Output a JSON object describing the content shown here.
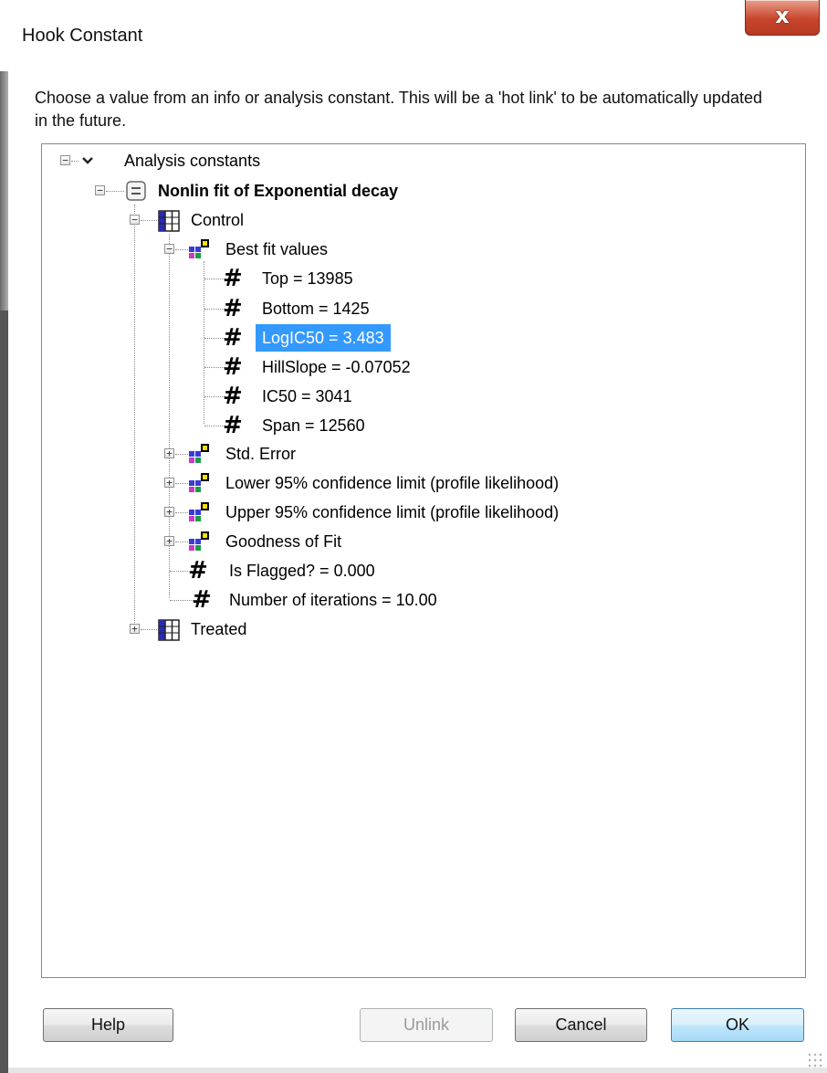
{
  "window": {
    "title": "Hook Constant",
    "close_glyph": "x"
  },
  "description": "Choose a value from an info or analysis constant. This will be a 'hot link' to be automatically updated in the future.",
  "tree": {
    "root": "Analysis constants",
    "analysis": "Nonlin fit of Exponential decay",
    "control": "Control",
    "best_fit": "Best fit values",
    "values": [
      "Top = 13985",
      "Bottom = 1425",
      "LogIC50 = 3.483",
      "HillSlope = -0.07052",
      "IC50 = 3041",
      "Span = 12560"
    ],
    "groups": [
      "Std. Error",
      "Lower 95% confidence limit (profile likelihood)",
      "Upper 95% confidence limit (profile likelihood)",
      "Goodness of Fit"
    ],
    "flagged": "Is Flagged? = 0.000",
    "iterations": "Number of iterations = 10.00",
    "treated": "Treated",
    "hash_glyph": "#",
    "selected_item": "LogIC50 = 3.483"
  },
  "buttons": {
    "help": "Help",
    "unlink": "Unlink",
    "cancel": "Cancel",
    "ok": "OK"
  },
  "icons": {
    "result_group": "colored-squares-icon",
    "table": "data-table-icon",
    "analysis": "analysis-sheet-icon",
    "value": "hash-icon"
  },
  "colors": {
    "selection": "#3399ff",
    "close_button": "#c8452c",
    "default_button_border": "#3c7fb1"
  }
}
